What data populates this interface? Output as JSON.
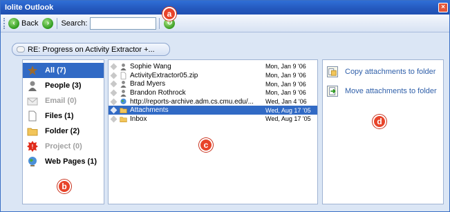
{
  "window": {
    "title": "Iolite Outlook",
    "close_glyph": "×"
  },
  "toolbar": {
    "back_label": "Back",
    "forward_glyph": "›",
    "back_glyph": "‹",
    "search_label": "Search:",
    "search_value": "",
    "refresh_glyph": "↻"
  },
  "breadcrumb": {
    "label": "RE: Progress on Activity Extractor +..."
  },
  "categories": [
    {
      "label": "All (7)",
      "icon": "star-icon"
    },
    {
      "label": "People (3)",
      "icon": "person-icon"
    },
    {
      "label": "Email (0)",
      "icon": "envelope-icon"
    },
    {
      "label": "Files (1)",
      "icon": "file-icon"
    },
    {
      "label": "Folder (2)",
      "icon": "folder-icon"
    },
    {
      "label": "Project (0)",
      "icon": "project-icon"
    },
    {
      "label": "Web Pages (1)",
      "icon": "globe-icon"
    }
  ],
  "items": [
    {
      "name": "Sophie Wang",
      "date": "Mon, Jan 9 '06",
      "icon": "person-icon"
    },
    {
      "name": "ActivityExtractor05.zip",
      "date": "Mon, Jan 9 '06",
      "icon": "file-icon"
    },
    {
      "name": "Brad Myers",
      "date": "Mon, Jan 9 '06",
      "icon": "person-icon"
    },
    {
      "name": "Brandon Rothrock",
      "date": "Mon, Jan 9 '06",
      "icon": "person-icon"
    },
    {
      "name": "http://reports-archive.adm.cs.cmu.edu/...",
      "date": "Wed, Jan 4 '06",
      "icon": "globe-icon"
    },
    {
      "name": "Attachments",
      "date": "Wed, Aug 17 '05",
      "icon": "folder-icon"
    },
    {
      "name": "Inbox",
      "date": "Wed, Aug 17 '05",
      "icon": "folder-icon"
    }
  ],
  "actions": [
    {
      "label": "Copy attachments to folder",
      "icon": "copy-icon"
    },
    {
      "label": "Move attachments to folder",
      "icon": "move-icon"
    }
  ],
  "callouts": {
    "a": "a",
    "b": "b",
    "c": "c",
    "d": "d"
  },
  "colors": {
    "selection": "#316ac5",
    "link": "#2f5fa9",
    "callout": "#e8442a"
  }
}
